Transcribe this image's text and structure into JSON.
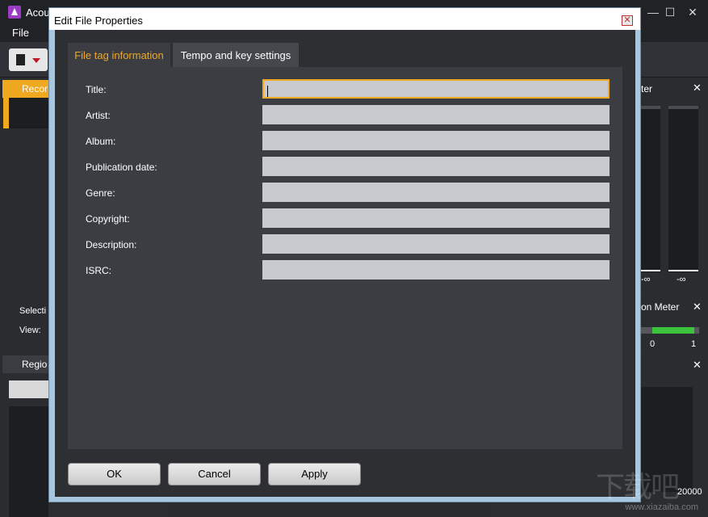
{
  "app": {
    "title": "Acou",
    "menu": {
      "file": "File"
    },
    "win_controls": {
      "minimize": "—",
      "maximize": "☐",
      "close": "✕"
    },
    "left_panel": {
      "record_tab": "Recor",
      "region_tab": "Regio",
      "selection_label": "Selecti",
      "view_label": "View:"
    },
    "right_panel": {
      "meter_tab": "ter",
      "meter_left_value": "-∞",
      "meter_right_value": "-∞",
      "correlation_tab": "on Meter",
      "correlation_min": "0",
      "correlation_max": "1",
      "freq_value": "20000"
    },
    "watermark": "www.xiazaiba.com"
  },
  "dialog": {
    "title": "Edit File Properties",
    "tabs": [
      {
        "label": "File tag information",
        "active": true
      },
      {
        "label": "Tempo and key settings",
        "active": false
      }
    ],
    "fields": [
      {
        "label": "Title:",
        "value": ""
      },
      {
        "label": "Artist:",
        "value": ""
      },
      {
        "label": "Album:",
        "value": ""
      },
      {
        "label": "Publication date:",
        "value": ""
      },
      {
        "label": "Genre:",
        "value": ""
      },
      {
        "label": "Copyright:",
        "value": ""
      },
      {
        "label": "Description:",
        "value": ""
      },
      {
        "label": "ISRC:",
        "value": ""
      }
    ],
    "buttons": {
      "ok": "OK",
      "cancel": "Cancel",
      "apply": "Apply"
    }
  },
  "colors": {
    "accent": "#f0a820",
    "dialog_frame": "#a7c6df",
    "panel_bg": "#3b3d43",
    "input_bg": "#c8cad0"
  },
  "icons": {
    "app_logo": "acoustica-logo-icon",
    "new_file": "document-icon",
    "dropdown": "chevron-down-icon",
    "dialog_close": "close-icon"
  }
}
